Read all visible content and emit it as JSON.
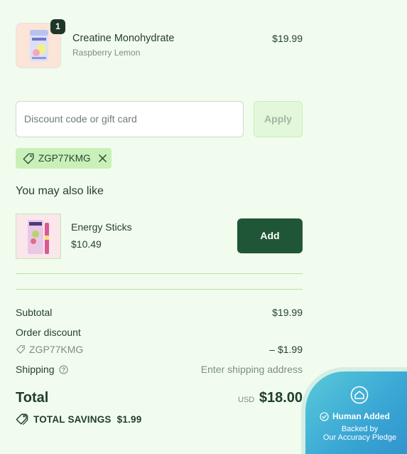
{
  "line_item": {
    "quantity": "1",
    "title": "Creatine Monohydrate",
    "variant": "Raspberry Lemon",
    "price": "$19.99"
  },
  "discount": {
    "placeholder": "Discount code or gift card",
    "apply_label": "Apply",
    "applied_code": "ZGP77KMG"
  },
  "upsell": {
    "heading": "You may also like",
    "product_name": "Energy Sticks",
    "product_price": "$10.49",
    "add_label": "Add"
  },
  "summary": {
    "subtotal_label": "Subtotal",
    "subtotal_value": "$19.99",
    "order_discount_label": "Order discount",
    "discount_code": "ZGP77KMG",
    "discount_value": "– $1.99",
    "shipping_label": "Shipping",
    "shipping_value": "Enter shipping address",
    "total_label": "Total",
    "currency": "USD",
    "total_value": "$18.00",
    "savings_label": "TOTAL SAVINGS",
    "savings_value": "$1.99"
  },
  "pledge": {
    "title": "Human Added",
    "line1": "Backed by",
    "line2": "Our Accuracy Pledge"
  },
  "icons": {
    "tag": "tag-icon",
    "close": "close-icon",
    "help": "question-circle-icon",
    "savings": "savings-tag-icon",
    "pledge": "shield-home-icon",
    "check": "check-circle-icon"
  },
  "colors": {
    "background": "#f2fcee",
    "primary_button": "#1f5637",
    "chip": "#c9f0b8",
    "text": "#1f3d2c",
    "muted": "#7b8f80",
    "pledge_gradient_start": "#59c9d9",
    "pledge_gradient_end": "#2f8fcc"
  }
}
